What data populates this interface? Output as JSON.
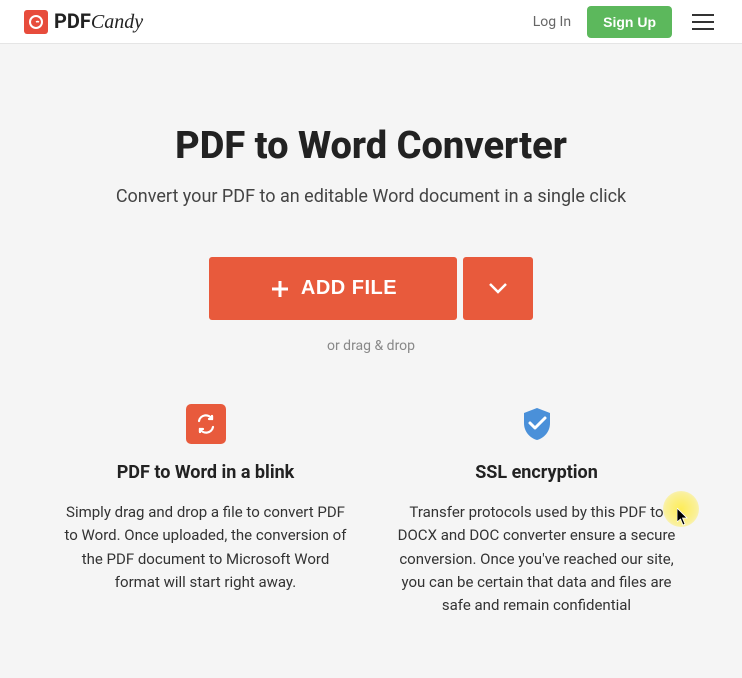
{
  "header": {
    "logo_pdf": "PDF",
    "logo_candy": "Candy",
    "login_label": "Log In",
    "signup_label": "Sign Up"
  },
  "main": {
    "title": "PDF to Word Converter",
    "subtitle": "Convert your PDF to an editable Word document in a single click",
    "add_file_label": "ADD FILE",
    "drag_text": "or drag & drop"
  },
  "features": [
    {
      "title": "PDF to Word in a blink",
      "description": "Simply drag and drop a file to convert PDF to Word. Once uploaded, the conversion of the PDF document to Microsoft Word format will start right away."
    },
    {
      "title": "SSL encryption",
      "description": "Transfer protocols used by this PDF to DOCX and DOC converter ensure a secure conversion. Once you've reached our site, you can be certain that data and files are safe and remain confidential"
    }
  ]
}
